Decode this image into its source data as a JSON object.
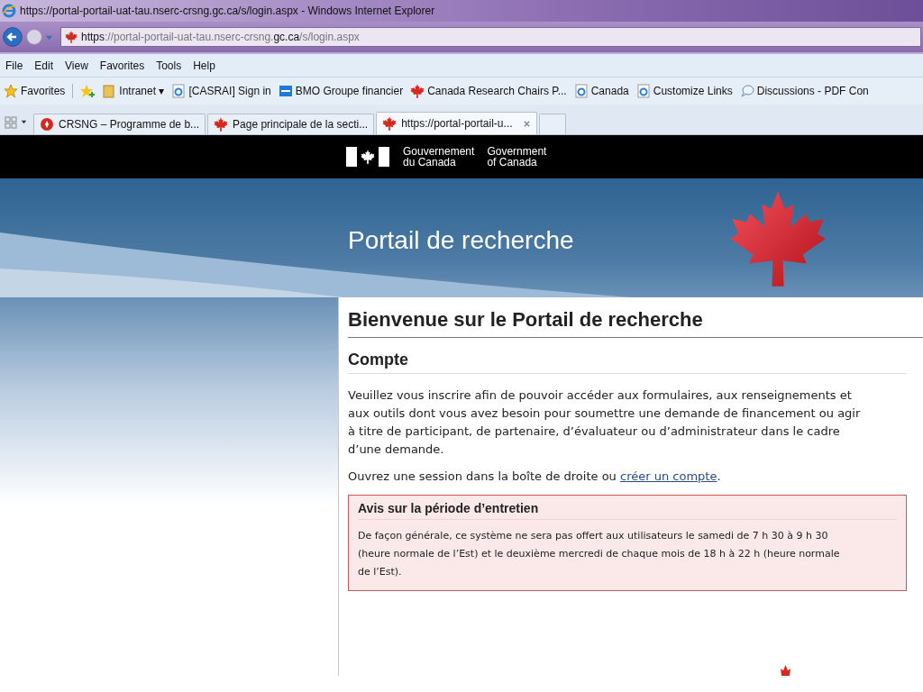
{
  "window": {
    "title": "https://portal-portail-uat-tau.nserc-crsng.gc.ca/s/login.aspx - Windows Internet Explorer"
  },
  "address_bar": {
    "url_parts": [
      {
        "text": "https",
        "emphasis": true
      },
      {
        "text": "://portal-portail-uat-tau.nserc-crsng.",
        "emphasis": false
      },
      {
        "text": "gc.ca",
        "emphasis": true
      },
      {
        "text": "/s/login.aspx",
        "emphasis": false
      }
    ]
  },
  "menu": [
    "File",
    "Edit",
    "View",
    "Favorites",
    "Tools",
    "Help"
  ],
  "favorites_bar": [
    {
      "kind": "star",
      "label": "Favorites"
    },
    {
      "kind": "add"
    },
    {
      "kind": "folder",
      "label": "Intranet ▾"
    },
    {
      "kind": "ie",
      "label": "[CASRAI] Sign in"
    },
    {
      "kind": "bmo",
      "label": "BMO Groupe financier"
    },
    {
      "kind": "leaf",
      "label": "Canada Research Chairs P..."
    },
    {
      "kind": "ie",
      "label": "Canada"
    },
    {
      "kind": "ie",
      "label": "Customize Links"
    },
    {
      "kind": "chat",
      "label": "Discussions - PDF Con"
    }
  ],
  "tabs": [
    {
      "kind": "circle",
      "label": "CRSNG – Programme de b...",
      "selected": false
    },
    {
      "kind": "leaf",
      "label": "Page principale de la secti...",
      "selected": false
    },
    {
      "kind": "leaf",
      "label": "https://portal-portail-u...",
      "selected": true
    }
  ],
  "gov_header": {
    "fr": [
      "Gouvernement",
      "du Canada"
    ],
    "en": [
      "Government",
      "of Canada"
    ]
  },
  "banner": {
    "title": "Portail de recherche"
  },
  "content": {
    "heading": "Bienvenue sur le Portail de recherche",
    "section": "Compte",
    "paragraph": "Veuillez vous inscrire afin de pouvoir accéder aux formulaires, aux renseignements et aux outils dont vous avez besoin pour soumettre une demande de financement ou agir à titre de participant, de partenaire, d’évaluateur ou d’administrateur dans le cadre d’une demande.",
    "login_before": "Ouvrez une session dans la boîte de droite ou ",
    "login_link": "créer un compte",
    "login_after": ".",
    "notice": {
      "title": "Avis sur la période d’entretien",
      "body": "De façon générale, ce système ne sera pas offert aux utilisateurs le samedi de 7 h 30 à 9 h 30 (heure normale de l’Est) et le deuxième mercredi de chaque mois de 18 h à 22 h (heure normale de l’Est)."
    }
  }
}
